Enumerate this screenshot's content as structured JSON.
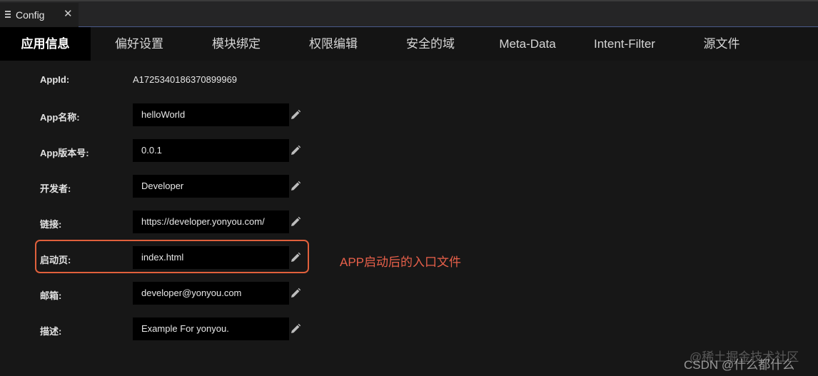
{
  "window": {
    "tab_title": "Config",
    "close_symbol": "✕"
  },
  "nav": {
    "tabs": [
      {
        "label": "应用信息"
      },
      {
        "label": "偏好设置"
      },
      {
        "label": "模块绑定"
      },
      {
        "label": "权限编辑"
      },
      {
        "label": "安全的域"
      },
      {
        "label": "Meta-Data"
      },
      {
        "label": "Intent-Filter"
      },
      {
        "label": "源文件"
      }
    ]
  },
  "form": {
    "appid": {
      "label": "AppId:",
      "value": "A1725340186370899969"
    },
    "fields": [
      {
        "label": "App名称:",
        "value": "helloWorld"
      },
      {
        "label": "App版本号:",
        "value": "0.0.1"
      },
      {
        "label": "开发者:",
        "value": "Developer"
      },
      {
        "label": "链接:",
        "value": "https://developer.yonyou.com/"
      },
      {
        "label": "启动页:",
        "value": "index.html"
      },
      {
        "label": "邮箱:",
        "value": "developer@yonyou.com"
      },
      {
        "label": "描述:",
        "value": "Example For yonyou."
      }
    ]
  },
  "annotation": {
    "text": "APP启动后的入口文件",
    "color": "#e8604a"
  },
  "watermarks": {
    "line1": "@稀土掘金技术社区",
    "line2": "CSDN @什么都什么"
  },
  "colors": {
    "highlight_border": "#e0603c",
    "accent_line": "#4a5a8a"
  },
  "icons": {
    "tab_menu": "menu-lines-icon",
    "field_edit": "pencil-icon"
  }
}
